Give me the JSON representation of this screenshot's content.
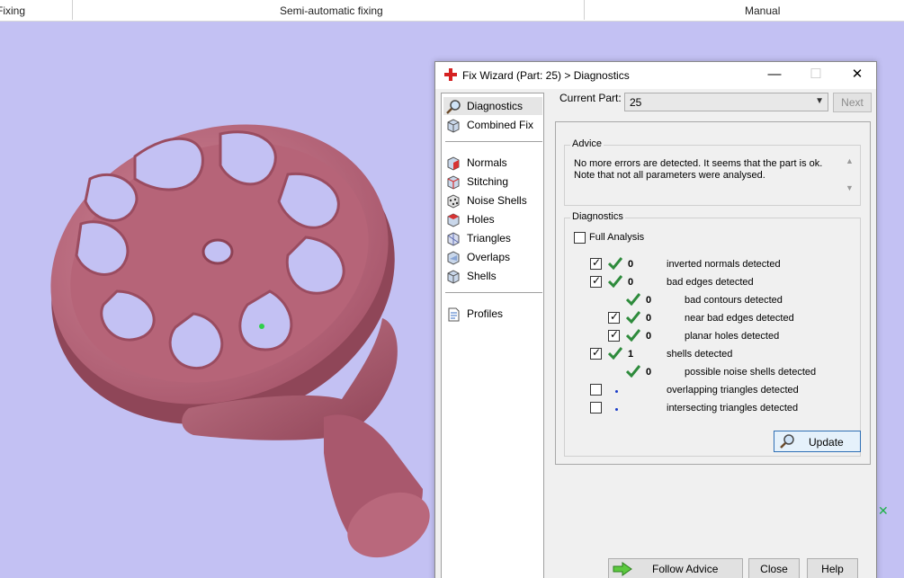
{
  "ribbon": {
    "groups": [
      "Fixing",
      "Semi-automatic fixing",
      "Manual"
    ]
  },
  "dialog": {
    "title": "Fix Wizard (Part: 25) > Diagnostics",
    "controls": {
      "minimize": "—",
      "maximize": "☐",
      "close": "✕"
    },
    "nav": {
      "items": [
        {
          "label": "Diagnostics",
          "icon": "magnifier-icon",
          "selected": true
        },
        {
          "label": "Combined Fix",
          "icon": "cube-icon"
        },
        {
          "label": "Normals",
          "icon": "normals-cube-icon"
        },
        {
          "label": "Stitching",
          "icon": "stitching-cube-icon"
        },
        {
          "label": "Noise Shells",
          "icon": "noise-shells-icon"
        },
        {
          "label": "Holes",
          "icon": "holes-cube-icon"
        },
        {
          "label": "Triangles",
          "icon": "triangles-icon"
        },
        {
          "label": "Overlaps",
          "icon": "overlaps-icon"
        },
        {
          "label": "Shells",
          "icon": "shells-icon"
        },
        {
          "label": "Profiles",
          "icon": "document-icon"
        }
      ]
    },
    "current_part": {
      "label": "Current Part:",
      "value": "25"
    },
    "next_label": "Next",
    "advice": {
      "title": "Advice",
      "text": "No more errors are detected. It seems that the part is ok. Note that not all parameters were analysed."
    },
    "diagnostics": {
      "title": "Diagnostics",
      "full_analysis": {
        "label": "Full Analysis",
        "checked": false
      },
      "rows": [
        {
          "label": "inverted normals detected",
          "count": "0",
          "checked": true,
          "ok": true,
          "indent": 0
        },
        {
          "label": "bad edges detected",
          "count": "0",
          "checked": true,
          "ok": true,
          "indent": 0
        },
        {
          "label": "bad contours detected",
          "count": "0",
          "checked": null,
          "ok": true,
          "indent": 1
        },
        {
          "label": "near bad edges detected",
          "count": "0",
          "checked": true,
          "ok": true,
          "indent": 1
        },
        {
          "label": "planar holes detected",
          "count": "0",
          "checked": true,
          "ok": true,
          "indent": 1
        },
        {
          "label": "shells detected",
          "count": "1",
          "checked": true,
          "ok": true,
          "indent": 0
        },
        {
          "label": "possible noise shells detected",
          "count": "0",
          "checked": null,
          "ok": true,
          "indent": 1
        },
        {
          "label": "overlapping triangles detected",
          "count": "",
          "checked": false,
          "ok": false,
          "indent": 0
        },
        {
          "label": "intersecting triangles detected",
          "count": "",
          "checked": false,
          "ok": false,
          "indent": 0
        }
      ],
      "update_label": "Update"
    },
    "buttons": {
      "follow_advice": "Follow Advice",
      "close": "Close",
      "help": "Help"
    }
  },
  "colors": {
    "viewport_bg": "#c3c1f3",
    "part_fill": "#c07085",
    "check_green": "#2e8b3c"
  }
}
